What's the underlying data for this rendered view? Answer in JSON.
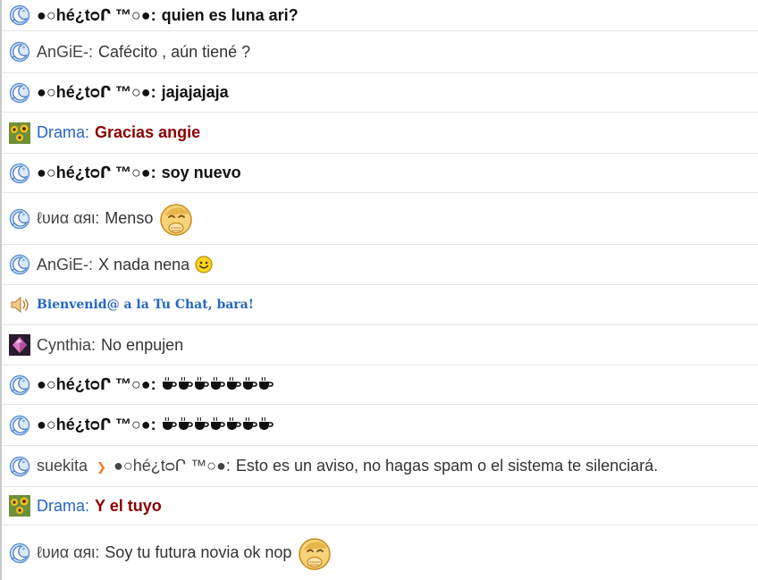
{
  "colors": {
    "nick_blue": "#2466c6",
    "message_red": "#8b0000",
    "border": "#e4e4e4"
  },
  "messages": [
    {
      "icon": "moon-avatar-icon",
      "nick": "●○hé¿tᴑՐ ™○●",
      "sep": ":",
      "text": "quien es luna ari?"
    },
    {
      "icon": "moon-avatar-icon",
      "nick": "AnGiE-",
      "sep": ":",
      "text": "Cafécito , aún tiené ?"
    },
    {
      "icon": "moon-avatar-icon",
      "nick": "●○hé¿tᴑՐ ™○●",
      "sep": ":",
      "text": "jajajajaja"
    },
    {
      "icon": "sunflower-avatar-icon",
      "nick": "Drama",
      "sep": ":",
      "text": "Gracias angie"
    },
    {
      "icon": "moon-avatar-icon",
      "nick": "●○hé¿tᴑՐ ™○●",
      "sep": ":",
      "text": "soy nuevo"
    },
    {
      "icon": "moon-avatar-icon",
      "nick": "ℓυиα αяι",
      "sep": ":",
      "text": "Menso",
      "emoji": "shy-laugh-emoji-icon"
    },
    {
      "icon": "moon-avatar-icon",
      "nick": "AnGiE-",
      "sep": ":",
      "text": "X nada nena",
      "emoji": "smile-emoji-icon"
    },
    {
      "icon": "speaker-icon",
      "text": "Bienvenid@ a la Tu Chat, bara!"
    },
    {
      "icon": "pink-gem-avatar-icon",
      "nick": "Cynthia",
      "sep": ":",
      "text": "No enpujen"
    },
    {
      "icon": "moon-avatar-icon",
      "nick": "●○hé¿tᴑՐ ™○●",
      "sep": ":",
      "cups": 7
    },
    {
      "icon": "moon-avatar-icon",
      "nick": "●○hé¿tᴑՐ ™○●",
      "sep": ":",
      "cups": 7
    },
    {
      "icon": "moon-avatar-icon",
      "nick": "suekita",
      "target": "●○hé¿tᴑՐ ™○●",
      "sep": ":",
      "text": "Esto es un aviso, no hagas spam o el sistema te silenciará."
    },
    {
      "icon": "sunflower-avatar-icon",
      "nick": "Drama",
      "sep": ":",
      "text": "Y el tuyo"
    },
    {
      "icon": "moon-avatar-icon",
      "nick": "ℓυиα αяι",
      "sep": ":",
      "text": "Soy tu futura novia ok nop",
      "emoji": "shy-laugh-emoji-icon"
    }
  ]
}
